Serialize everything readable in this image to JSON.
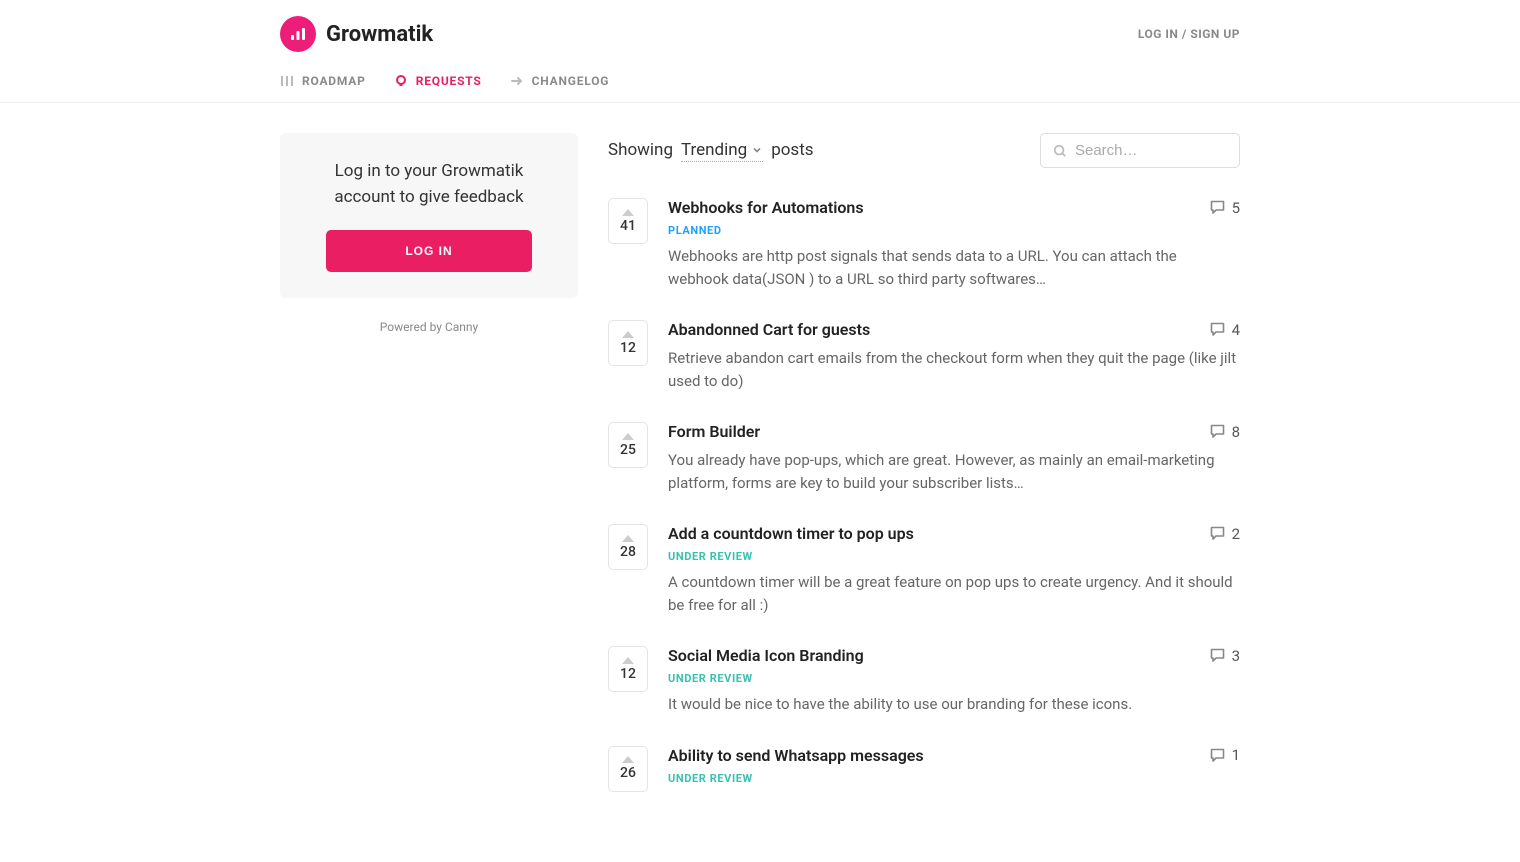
{
  "brand": {
    "name": "Growmatik"
  },
  "auth": {
    "login_signup": "LOG IN / SIGN UP"
  },
  "nav": {
    "roadmap": "ROADMAP",
    "requests": "REQUESTS",
    "changelog": "CHANGELOG"
  },
  "sidebar": {
    "login_prompt": "Log in to your Growmatik account to give feedback",
    "login_button": "LOG IN",
    "powered": "Powered by Canny"
  },
  "filter": {
    "showing": "Showing",
    "sort": "Trending",
    "posts": "posts"
  },
  "search": {
    "placeholder": "Search…"
  },
  "status_labels": {
    "planned": "PLANNED",
    "under_review": "UNDER REVIEW"
  },
  "posts": [
    {
      "votes": "41",
      "title": "Webhooks for Automations",
      "status_key": "planned",
      "comments": "5",
      "desc": "Webhooks are http post signals that sends data to a URL. You can attach the webhook data(JSON ) to a URL so third party softwares…"
    },
    {
      "votes": "12",
      "title": "Abandonned Cart for guests",
      "status_key": null,
      "comments": "4",
      "desc": "Retrieve abandon cart emails from the checkout form when they quit the page (like jilt used to do)"
    },
    {
      "votes": "25",
      "title": "Form Builder",
      "status_key": null,
      "comments": "8",
      "desc": "You already have pop-ups, which are great. However, as mainly an email-marketing platform, forms are key to build your subscriber lists…"
    },
    {
      "votes": "28",
      "title": "Add a countdown timer to pop ups",
      "status_key": "under_review",
      "comments": "2",
      "desc": "A countdown timer will be a great feature on pop ups to create urgency. And it should be free for all :)"
    },
    {
      "votes": "12",
      "title": "Social Media Icon Branding",
      "status_key": "under_review",
      "comments": "3",
      "desc": "It would be nice to have the ability to use our branding for these icons."
    },
    {
      "votes": "26",
      "title": "Ability to send Whatsapp messages",
      "status_key": "under_review",
      "comments": "1",
      "desc": ""
    }
  ]
}
